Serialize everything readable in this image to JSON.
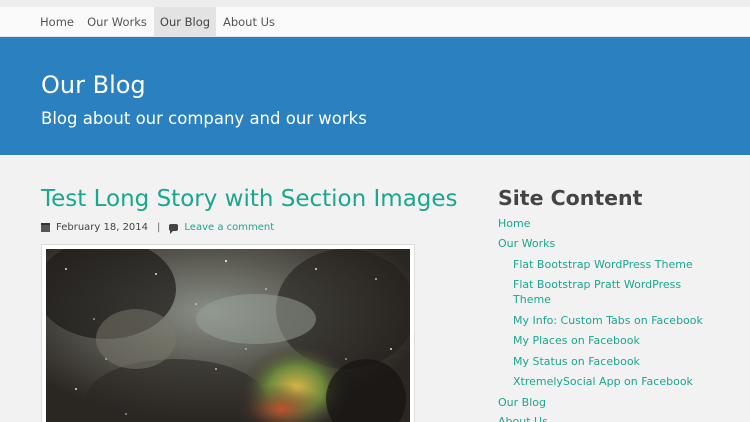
{
  "nav": {
    "items": [
      {
        "label": "Home",
        "active": false
      },
      {
        "label": "Our Works",
        "active": false
      },
      {
        "label": "Our Blog",
        "active": true
      },
      {
        "label": "About Us",
        "active": false
      }
    ]
  },
  "header": {
    "title": "Our Blog",
    "tagline": "Blog about our company and our works"
  },
  "post": {
    "title": "Test Long Story with Section Images",
    "date": "February 18, 2014",
    "separator": "|",
    "comment_link": "Leave a comment",
    "date_icon": "calendar-icon",
    "comment_icon": "comment-icon"
  },
  "sidebar": {
    "title": "Site Content",
    "links": [
      {
        "label": "Home"
      },
      {
        "label": "Our Works"
      },
      {
        "label": "Flat Bootstrap WordPress Theme"
      },
      {
        "label": "Flat Bootstrap Pratt WordPress Theme"
      },
      {
        "label": "My Info: Custom Tabs on Facebook"
      },
      {
        "label": "My Places on Facebook"
      },
      {
        "label": "My Status on Facebook"
      },
      {
        "label": "XtremelySocial App on Facebook"
      },
      {
        "label": "Our Blog"
      },
      {
        "label": "About Us"
      }
    ]
  },
  "colors": {
    "accent": "#1ba68f",
    "banner": "#2b80c0"
  }
}
